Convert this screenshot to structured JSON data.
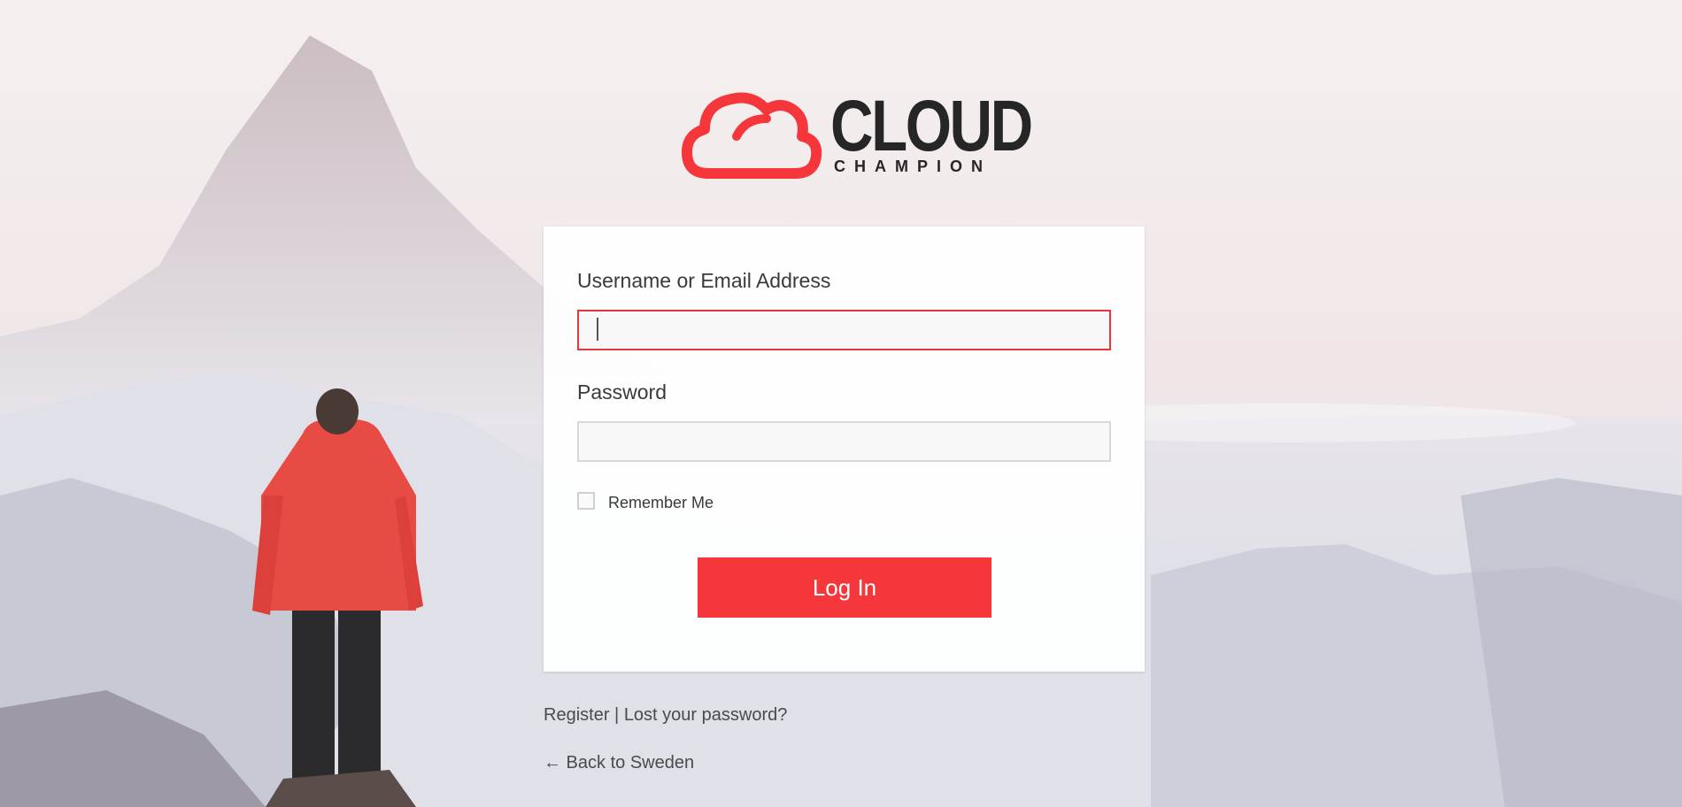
{
  "brand": {
    "name": "CLOUD",
    "tagline": "CHAMPION",
    "accent": "#f5373b",
    "text_color": "#262626"
  },
  "form": {
    "username_label": "Username or Email Address",
    "username_value": "",
    "password_label": "Password",
    "password_value": "",
    "remember_label": "Remember Me",
    "remember_checked": false,
    "submit_label": "Log In"
  },
  "links": {
    "register": "Register",
    "separator": "|",
    "lost_password": "Lost your password?",
    "back": "← Back to Sweden"
  }
}
